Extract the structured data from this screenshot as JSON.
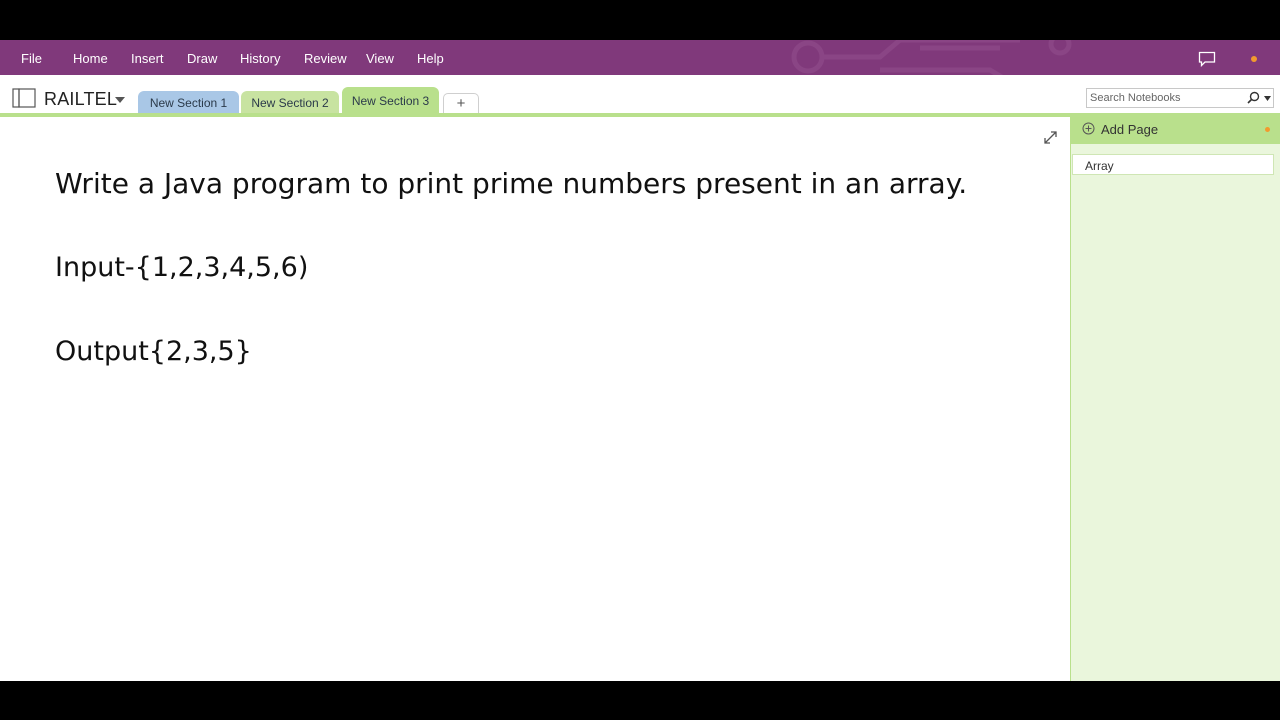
{
  "menu": {
    "items": [
      "File",
      "Home",
      "Insert",
      "Draw",
      "History",
      "Review",
      "View",
      "Help"
    ]
  },
  "notebook": {
    "name": "RAILTEL"
  },
  "sections": {
    "tabs": [
      "New Section 1",
      "New Section 2",
      "New Section 3"
    ],
    "active": "New Section 3",
    "add_label": "+"
  },
  "search": {
    "placeholder": "Search Notebooks"
  },
  "note": {
    "lines": [
      "Write a Java program to print prime numbers present in an array.",
      "Input-{1,2,3,4,5,6)",
      "Output{2,3,5}"
    ]
  },
  "pages": {
    "add_label": "Add Page",
    "items": [
      "Array"
    ]
  },
  "colors": {
    "menubar": "#80397b",
    "section1": "#a9c7e6",
    "section2": "#c8e3a1",
    "section3": "#b9e08c",
    "accent_dot": "#f29a2e"
  }
}
